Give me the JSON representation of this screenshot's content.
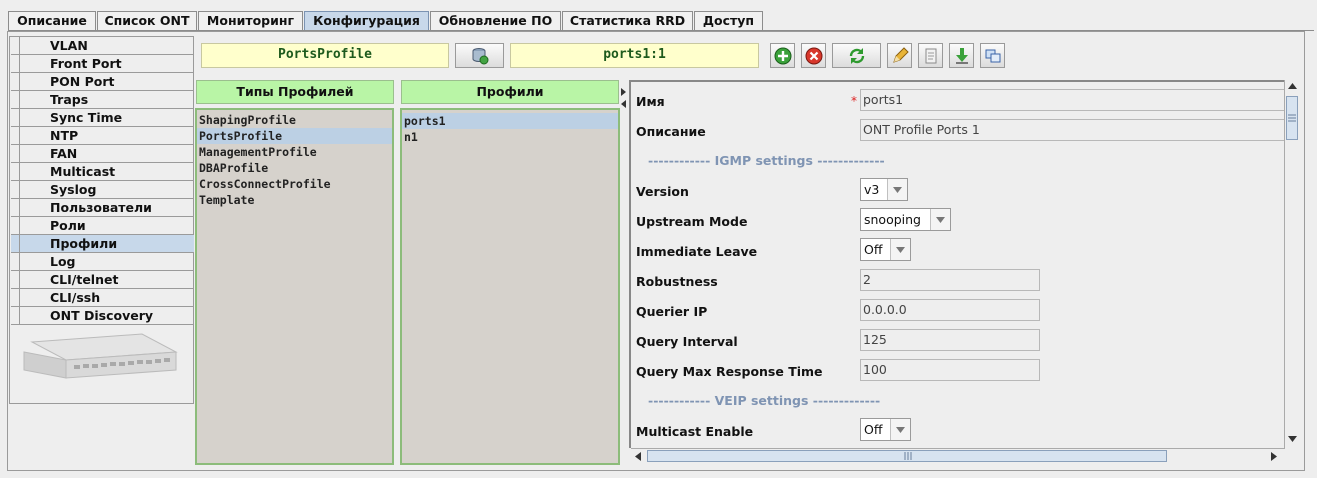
{
  "top_tabs": [
    {
      "label": "Описание"
    },
    {
      "label": "Список ONT"
    },
    {
      "label": "Мониторинг"
    },
    {
      "label": "Конфигурация"
    },
    {
      "label": "Обновление ПО"
    },
    {
      "label": "Статистика RRD"
    },
    {
      "label": "Доступ"
    }
  ],
  "active_tab": "Конфигурация",
  "sidebar": {
    "items": [
      {
        "label": "VLAN"
      },
      {
        "label": "Front Port"
      },
      {
        "label": "PON Port"
      },
      {
        "label": "Traps"
      },
      {
        "label": "Sync Time"
      },
      {
        "label": "NTP"
      },
      {
        "label": "FAN"
      },
      {
        "label": "Multicast"
      },
      {
        "label": "Syslog"
      },
      {
        "label": "Пользователи"
      },
      {
        "label": "Роли"
      },
      {
        "label": "Профили"
      },
      {
        "label": "Log"
      },
      {
        "label": "CLI/telnet"
      },
      {
        "label": "CLI/ssh"
      },
      {
        "label": "ONT Discovery"
      }
    ],
    "selected": "Профили"
  },
  "toolbar": {
    "profile_type": "PortsProfile",
    "profile_name": "ports1:1",
    "icons": [
      "database-icon",
      "add-icon",
      "delete-icon",
      "refresh-icon",
      "edit-icon",
      "copy-icon",
      "download-icon",
      "link-icon"
    ]
  },
  "profile_types": {
    "header": "Типы Профилей",
    "items": [
      "ShapingProfile",
      "PortsProfile",
      "ManagementProfile",
      "DBAProfile",
      "CrossConnectProfile",
      "Template"
    ],
    "selected": "PortsProfile"
  },
  "profiles": {
    "header": "Профили",
    "items": [
      "ports1",
      "n1"
    ],
    "selected": "ports1"
  },
  "form": {
    "name_label": "Имя",
    "name_value": "ports1",
    "required_mark": "*",
    "desc_label": "Описание",
    "desc_value": "ONT Profile Ports 1",
    "igmp_section": "------------ IGMP settings -------------",
    "version_label": "Version",
    "version_value": "v3",
    "upstream_label": "Upstream Mode",
    "upstream_value": "snooping",
    "immediate_label": "Immediate Leave",
    "immediate_value": "Off",
    "robustness_label": "Robustness",
    "robustness_value": "2",
    "querier_label": "Querier IP",
    "querier_value": "0.0.0.0",
    "interval_label": "Query Interval",
    "interval_value": "125",
    "maxresp_label": "Query Max Response Time",
    "maxresp_value": "100",
    "veip_section": "------------ VEIP settings -------------",
    "multicast_label": "Multicast Enable",
    "multicast_value": "Off"
  },
  "colors": {
    "accent_tab": "#c8d8ea",
    "list_header": "#b9f5a6",
    "yellow_field": "#ffffcc",
    "section_text": "#7f94b3"
  }
}
